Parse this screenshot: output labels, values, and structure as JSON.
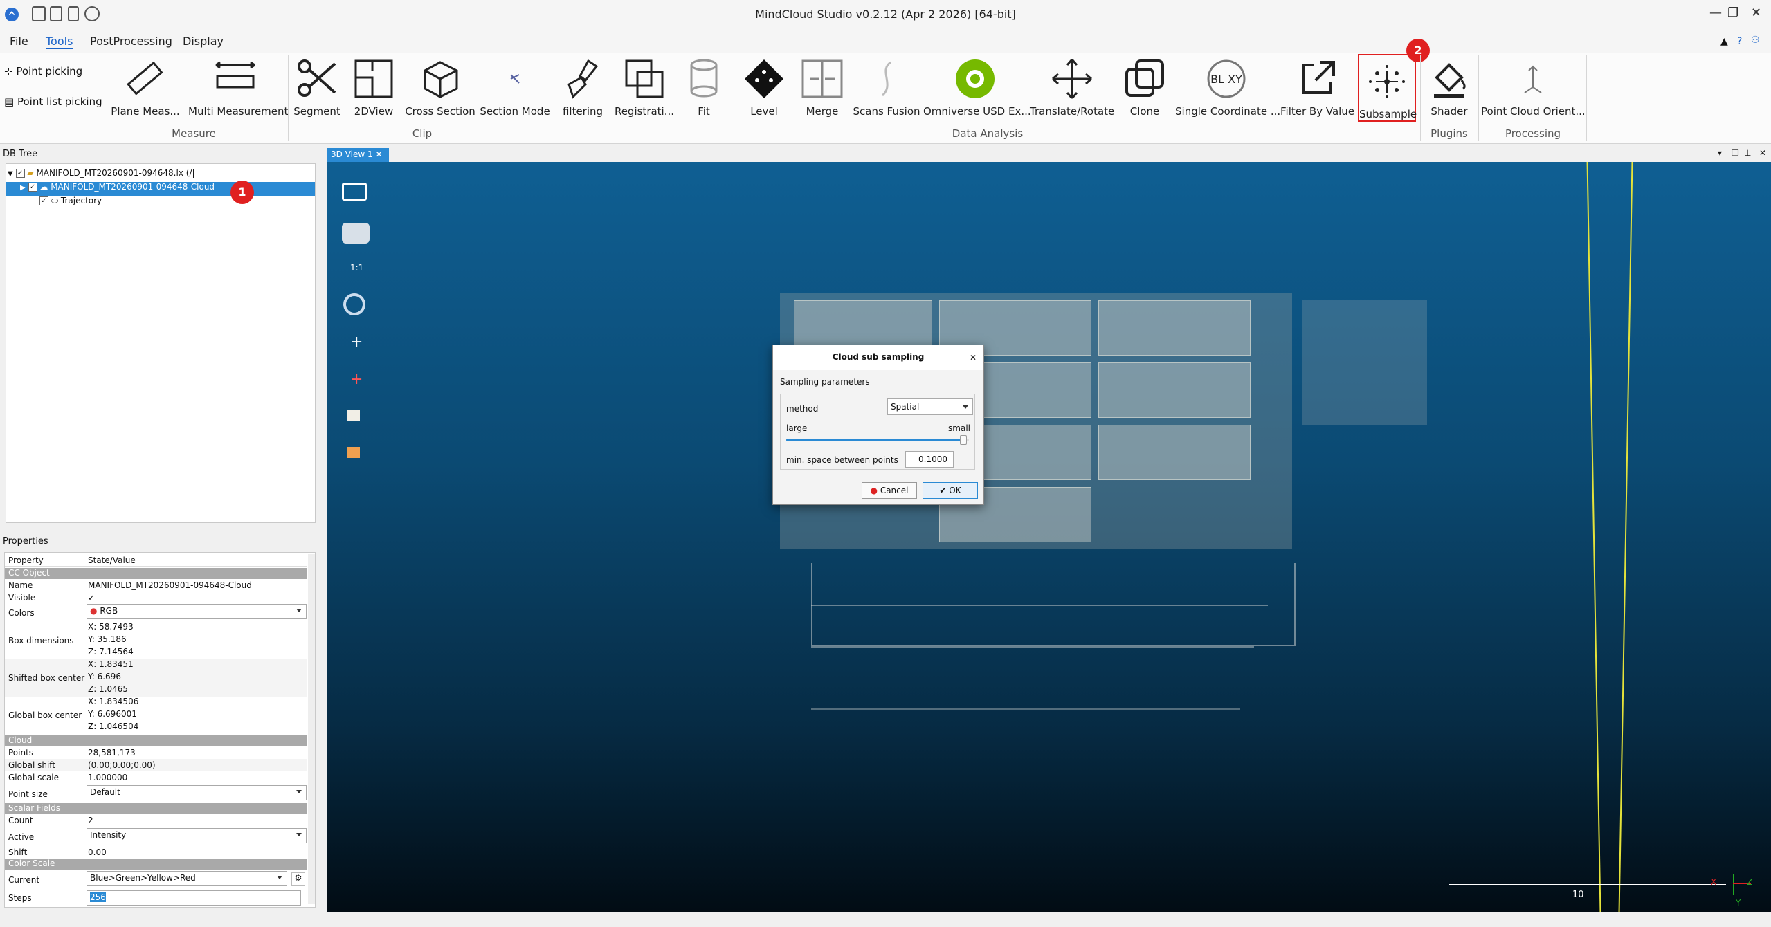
{
  "window": {
    "title": "MindCloud Studio v0.2.12 (Apr  2 2026) [64-bit]"
  },
  "menu": {
    "file": "File",
    "tools": "Tools",
    "postprocessing": "PostProcessing",
    "display": "Display"
  },
  "ribbon": {
    "point_picking": "Point picking",
    "point_list_picking": "Point list picking",
    "tools": {
      "plane_measure": "Plane Meas...",
      "multi_measurement": "Multi Measurement",
      "segment": "Segment",
      "view2d": "2DView",
      "cross_section": "Cross Section",
      "section_mode": "Section Mode",
      "filtering": "filtering",
      "registration": "Registrati...",
      "fit": "Fit",
      "level": "Level",
      "merge": "Merge",
      "scans_fusion": "Scans Fusion",
      "omniverse": "Omniverse USD Ex...",
      "translate_rotate": "Translate/Rotate",
      "clone": "Clone",
      "single_coordinate": "Single Coordinate ...",
      "filter_by_value": "Filter By Value",
      "subsample": "Subsample",
      "shader": "Shader",
      "point_cloud_orient": "Point Cloud Orient..."
    },
    "groups": {
      "measure": "Measure",
      "clip": "Clip",
      "data_analysis": "Data Analysis",
      "plugins": "Plugins",
      "processing": "Processing"
    },
    "coord_icon_text": "BL XY"
  },
  "db_tree": {
    "header": "DB Tree",
    "root": "MANIFOLD_MT20260901-094648.lx (/|",
    "cloud": "MANIFOLD_MT20260901-094648-Cloud",
    "trajectory": "Trajectory"
  },
  "badges": {
    "one": "1",
    "two": "2"
  },
  "properties": {
    "header": "Properties",
    "col_property": "Property",
    "col_value": "State/Value",
    "sec_cc_object": "CC Object",
    "name_key": "Name",
    "name_val": "MANIFOLD_MT20260901-094648-Cloud",
    "visible_key": "Visible",
    "colors_key": "Colors",
    "colors_val": "RGB",
    "box_dim_key": "Box dimensions",
    "box_dim": [
      "X: 58.7493",
      "Y: 35.186",
      "Z: 7.14564"
    ],
    "shifted_key": "Shifted box center",
    "shifted": [
      "X: 1.83451",
      "Y: 6.696",
      "Z: 1.0465"
    ],
    "global_center_key": "Global box center",
    "global_center": [
      "X: 1.834506",
      "Y: 6.696001",
      "Z: 1.046504"
    ],
    "sec_cloud": "Cloud",
    "points_key": "Points",
    "points_val": "28,581,173",
    "gshift_key": "Global shift",
    "gshift_val": "(0.00;0.00;0.00)",
    "gscale_key": "Global scale",
    "gscale_val": "1.000000",
    "psize_key": "Point size",
    "psize_val": "Default",
    "sec_scalar": "Scalar Fields",
    "count_key": "Count",
    "count_val": "2",
    "active_key": "Active",
    "active_val": "Intensity",
    "shift_key": "Shift",
    "shift_val": "0.00",
    "sec_color_scale": "Color Scale",
    "current_key": "Current",
    "current_val": "Blue>Green>Yellow>Red",
    "steps_key": "Steps",
    "steps_val": "256"
  },
  "view": {
    "tab": "3D View 1",
    "side_label_11": "1:1",
    "scale_label": "10",
    "axis_x": "X",
    "axis_y": "Y",
    "axis_z": "Z"
  },
  "dialog": {
    "title": "Cloud sub sampling",
    "section": "Sampling parameters",
    "method_label": "method",
    "method_value": "Spatial",
    "large": "large",
    "small": "small",
    "slider_level": 0.97,
    "min_space_label": "min. space between points",
    "min_space_value": "0.1000",
    "cancel": "Cancel",
    "ok": "OK"
  },
  "colors": {
    "accent": "#2a8ad4",
    "highlight": "#e02020",
    "tab_blue": "#2a8ad4"
  }
}
